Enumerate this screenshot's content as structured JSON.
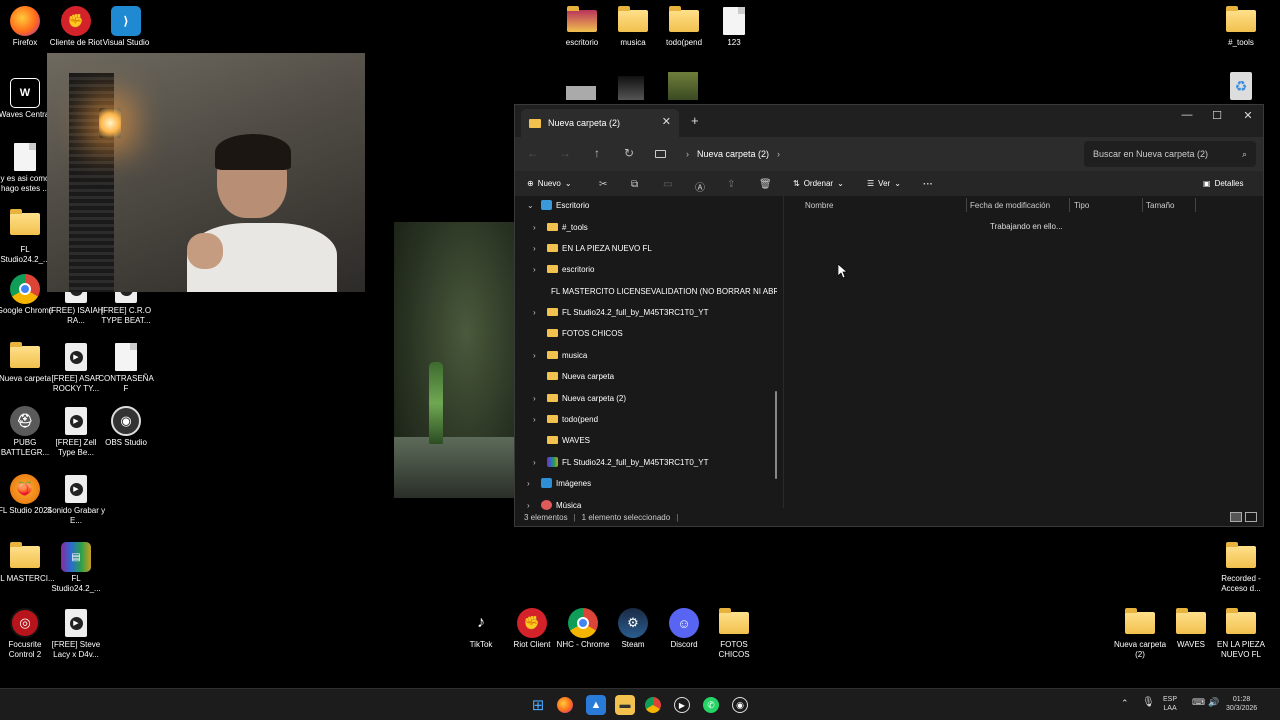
{
  "desktop_icons_left": [
    {
      "label": "Firefox"
    },
    {
      "label": "Cliente de Riot"
    },
    {
      "label": "Visual Studio Code"
    },
    {
      "label": "Waves Central"
    },
    {
      "label": "y es asi como hago estes ..."
    },
    {
      "label": "FL Studio24.2_..."
    },
    {
      "label": "Google Chrome"
    },
    {
      "label": "(FREE) ISAIAH RA..."
    },
    {
      "label": "[FREE] C.R.O TYPE BEAT..."
    },
    {
      "label": "Nueva carpeta"
    },
    {
      "label": "[FREE] ASAP ROCKY TY..."
    },
    {
      "label": "CONTRASEÑA F"
    },
    {
      "label": "PUBG BATTLEGR..."
    },
    {
      "label": "[FREE] Zell Type Be..."
    },
    {
      "label": "OBS Studio"
    },
    {
      "label": "FL Studio 2024"
    },
    {
      "label": "Sonido Grabar y E..."
    },
    {
      "label": "FL MASTERCI..."
    },
    {
      "label": "FL Studio24.2_..."
    },
    {
      "label": "Focusrite Control 2"
    },
    {
      "label": "[FREE] Steve Lacy x D4v..."
    }
  ],
  "desktop_icons_top": [
    {
      "label": "escritorio"
    },
    {
      "label": "musica"
    },
    {
      "label": "todo(pend"
    },
    {
      "label": "123"
    },
    {
      "label": "#_tools"
    }
  ],
  "desktop_icons_bottom": [
    {
      "label": "TikTok"
    },
    {
      "label": "Riot Client"
    },
    {
      "label": "NHC - Chrome"
    },
    {
      "label": "Steam"
    },
    {
      "label": "Discord"
    },
    {
      "label": "FOTOS CHICOS"
    },
    {
      "label": "Nueva carpeta (2)"
    },
    {
      "label": "WAVES"
    },
    {
      "label": "EN LA PIEZA NUEVO FL"
    },
    {
      "label": "Recorded - Acceso d..."
    }
  ],
  "explorer": {
    "tab_title": "Nueva carpeta (2)",
    "breadcrumb": "Nueva carpeta (2)",
    "search_placeholder": "Buscar en Nueva carpeta (2)",
    "toolbar": {
      "nuevo": "Nuevo",
      "ordenar": "Ordenar",
      "ver": "Ver",
      "more": "···",
      "detalles": "Detalles"
    },
    "tree": [
      {
        "label": "Escritorio",
        "level": 0,
        "expanded": true,
        "icon": "desktop"
      },
      {
        "label": "#_tools",
        "level": 1,
        "has_children": true
      },
      {
        "label": "EN LA PIEZA NUEVO FL",
        "level": 1,
        "has_children": true
      },
      {
        "label": "escritorio",
        "level": 1,
        "has_children": true
      },
      {
        "label": "FL MASTERCITO LICENSEVALIDATION (NO BORRAR NI ABR",
        "level": 1,
        "has_children": false
      },
      {
        "label": "FL Studio24.2_full_by_M45T3RC1T0_YT",
        "level": 1,
        "has_children": true
      },
      {
        "label": "FOTOS CHICOS",
        "level": 1,
        "has_children": false
      },
      {
        "label": "musica",
        "level": 1,
        "has_children": true
      },
      {
        "label": "Nueva carpeta",
        "level": 1,
        "has_children": false
      },
      {
        "label": "Nueva carpeta (2)",
        "level": 1,
        "has_children": true
      },
      {
        "label": "todo(pend",
        "level": 1,
        "has_children": true
      },
      {
        "label": "WAVES",
        "level": 1,
        "has_children": false
      },
      {
        "label": "FL Studio24.2_full_by_M45T3RC1T0_YT",
        "level": 1,
        "has_children": true,
        "icon": "archive"
      },
      {
        "label": "Imágenes",
        "level": 0,
        "has_children": true,
        "icon": "pictures"
      },
      {
        "label": "Música",
        "level": 0,
        "has_children": true,
        "icon": "music"
      }
    ],
    "columns": [
      "Nombre",
      "Fecha de modificación",
      "Tipo",
      "Tamaño"
    ],
    "working_text": "Trabajando en ello...",
    "status": {
      "items": "3 elementos",
      "selected": "1 elemento seleccionado"
    }
  },
  "taskbar": {
    "lang": "ESP",
    "lang2": "LAA",
    "time": "01:28",
    "date": "30/3/2026"
  }
}
